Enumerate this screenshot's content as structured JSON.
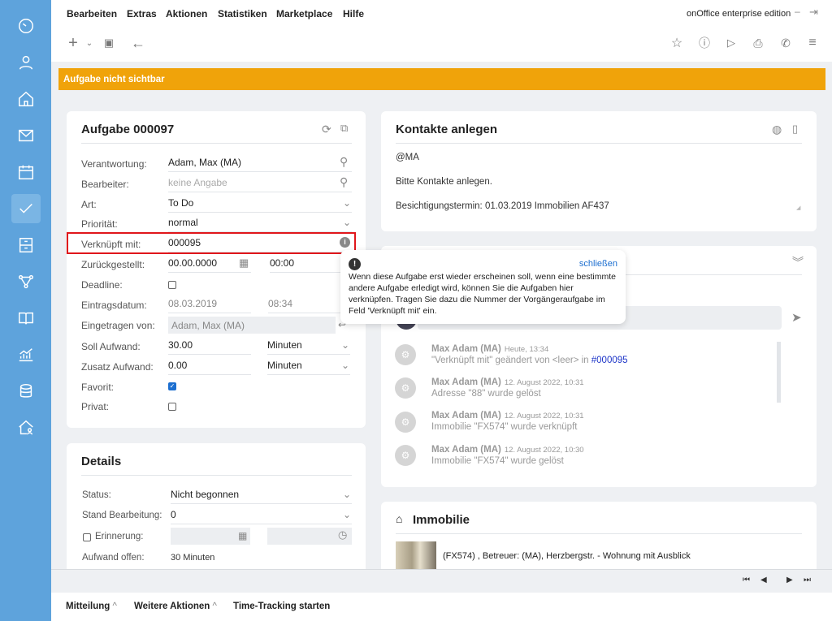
{
  "menu": {
    "items": [
      "Bearbeiten",
      "Extras",
      "Aktionen",
      "Statistiken",
      "Marketplace",
      "Hilfe"
    ],
    "edition": "onOffice enterprise edition"
  },
  "banner": "Aufgabe nicht sichtbar",
  "task": {
    "title": "Aufgabe 000097",
    "fields": {
      "verantwortung": {
        "label": "Verantwortung:",
        "value": "Adam, Max (MA)"
      },
      "bearbeiter": {
        "label": "Bearbeiter:",
        "placeholder": "keine Angabe"
      },
      "art": {
        "label": "Art:",
        "value": "To Do"
      },
      "prioritaet": {
        "label": "Priorität:",
        "value": "normal"
      },
      "verknuepft": {
        "label": "Verknüpft mit:",
        "value": "000095"
      },
      "zurueck": {
        "label": "Zurückgestellt:",
        "date": "00.00.0000",
        "time": "00:00"
      },
      "deadline": {
        "label": "Deadline:",
        "checked": false
      },
      "eintrag": {
        "label": "Eintragsdatum:",
        "date": "08.03.2019",
        "time": "08:34"
      },
      "eingetragen": {
        "label": "Eingetragen von:",
        "value": "Adam, Max (MA)"
      },
      "soll": {
        "label": "Soll Aufwand:",
        "value": "30.00",
        "unit": "Minuten"
      },
      "zusatz": {
        "label": "Zusatz Aufwand:",
        "value": "0.00",
        "unit": "Minuten"
      },
      "favorit": {
        "label": "Favorit:",
        "checked": true
      },
      "privat": {
        "label": "Privat:",
        "checked": false
      }
    }
  },
  "details": {
    "title": "Details",
    "status": {
      "label": "Status:",
      "value": "Nicht begonnen"
    },
    "stand": {
      "label": "Stand Bearbeitung:",
      "value": "0"
    },
    "erinnerung": {
      "label": "Erinnerung:"
    },
    "aufwand": {
      "label": "Aufwand offen:",
      "value": "30 Minuten"
    }
  },
  "kontakte": {
    "title": "Kontakte anlegen",
    "lines": [
      "@MA",
      "Bitte Kontakte anlegen.",
      "Besichtigungstermin: 01.03.2019 Immobilien AF437"
    ]
  },
  "tooltip": {
    "close": "schließen",
    "text": "Wenn diese Aufgabe erst wieder erscheinen soll, wenn eine bestimmte andere Aufgabe erledigt wird, können Sie die Aufgaben hier verknüpfen. Tragen Sie dazu die Nummer der Vorgängeraufgabe im Feld 'Verknüpft mit' ein."
  },
  "activity": [
    {
      "name": "Max Adam (MA)",
      "time": "Heute, 13:34",
      "text": "\"Verknüpft mit\" geändert von <leer> in ",
      "link": "#000095"
    },
    {
      "name": "Max Adam (MA)",
      "time": "12. August 2022, 10:31",
      "text": "Adresse \"88\" wurde gelöst"
    },
    {
      "name": "Max Adam (MA)",
      "time": "12. August 2022, 10:31",
      "text": "Immobilie \"FX574\" wurde verknüpft"
    },
    {
      "name": "Max Adam (MA)",
      "time": "12. August 2022, 10:30",
      "text": "Immobilie \"FX574\" wurde gelöst"
    }
  ],
  "immobilie": {
    "title": "Immobilie",
    "entry": "(FX574) , Betreuer: (MA), Herzbergstr. - Wohnung mit Ausblick"
  },
  "footer": {
    "mitteilung": "Mitteilung",
    "weitere": "Weitere Aktionen",
    "timetracking": "Time-Tracking starten"
  },
  "colors": {
    "sidebar": "#5ea3dc",
    "banner": "#f0a30a",
    "highlight": "#e0161b",
    "link": "#1d6fd0"
  }
}
